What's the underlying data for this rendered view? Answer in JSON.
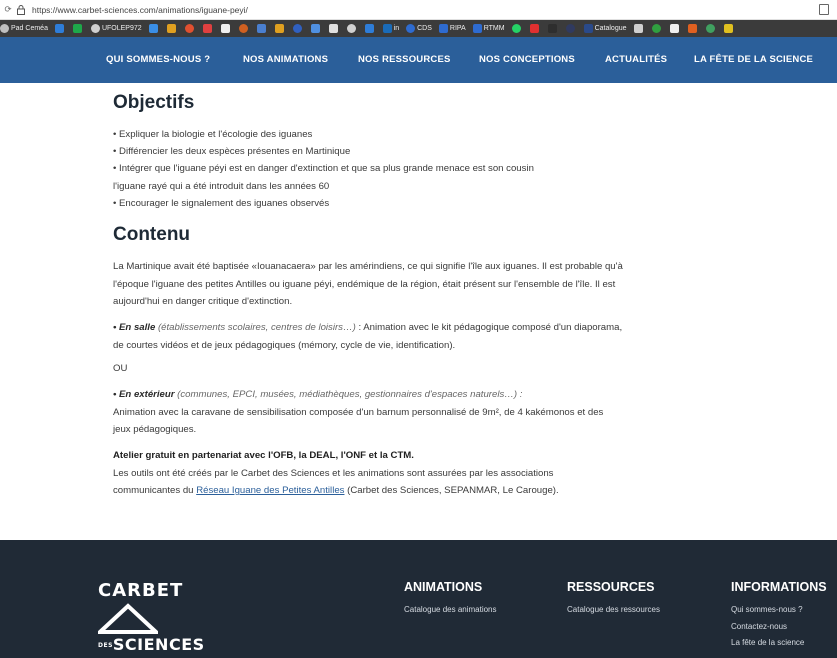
{
  "browser": {
    "url": "https://www.carbet-sciences.com/animations/iguane-peyi/",
    "bookmarks": [
      {
        "label": "Pad Ceméa",
        "color": "#bfbfbf"
      },
      {
        "label": "",
        "color": "#2e7dd8"
      },
      {
        "label": "",
        "color": "#1ea84a"
      },
      {
        "label": "UFOLEP972",
        "color": "#d0d0d0"
      },
      {
        "label": "",
        "color": "#3a8ee6"
      },
      {
        "label": "",
        "color": "#e0a020"
      },
      {
        "label": "",
        "color": "#e05030"
      },
      {
        "label": "",
        "color": "#e04040"
      },
      {
        "label": "",
        "color": "#f0f0f0"
      },
      {
        "label": "",
        "color": "#d06020"
      },
      {
        "label": "",
        "color": "#4a7fd0"
      },
      {
        "label": "",
        "color": "#e0a020"
      },
      {
        "label": "",
        "color": "#3060c0"
      },
      {
        "label": "",
        "color": "#5090e0"
      },
      {
        "label": "",
        "color": "#e0e0e0"
      },
      {
        "label": "",
        "color": "#d0d0d0"
      },
      {
        "label": "",
        "color": "#2e7dd8"
      },
      {
        "label": "in",
        "color": "#1a6bb8"
      },
      {
        "label": "CDS",
        "color": "#2e6bd0"
      },
      {
        "label": "RIPA",
        "color": "#2e6bd0"
      },
      {
        "label": "RTMM",
        "color": "#2e6bd0"
      },
      {
        "label": "",
        "color": "#25d366"
      },
      {
        "label": "",
        "color": "#e03030"
      },
      {
        "label": "",
        "color": "#2e2e2e"
      },
      {
        "label": "",
        "color": "#303a60"
      },
      {
        "label": "Catalogue",
        "color": "#2a4a8a"
      },
      {
        "label": "",
        "color": "#d0d0d0"
      },
      {
        "label": "",
        "color": "#30a040"
      },
      {
        "label": "",
        "color": "#f0f0f0"
      },
      {
        "label": "",
        "color": "#e06020"
      },
      {
        "label": "",
        "color": "#40a060"
      },
      {
        "label": "",
        "color": "#e0c020"
      }
    ]
  },
  "nav": {
    "items": [
      "QUI SOMMES-NOUS ?",
      "NOS ANIMATIONS",
      "NOS RESSOURCES",
      "NOS CONCEPTIONS",
      "ACTUALITÉS",
      "LA FÊTE DE LA SCIENCE"
    ]
  },
  "content": {
    "objectifs_title": "Objectifs",
    "objectifs": [
      "Expliquer la biologie et l'écologie des iguanes",
      "Différencier les deux espèces présentes en Martinique",
      "Intégrer que l'iguane péyi est en danger d'extinction et que sa plus grande menace est son cousin",
      "l'iguane rayé qui a été introduit dans les années 60",
      "Encourager le signalement des iguanes observés"
    ],
    "contenu_title": "Contenu",
    "p1": "La Martinique avait été baptisée «Iouanacaera» par les amérindiens, ce qui signifie l'île aux iguanes. Il est probable qu'à l'époque l'iguane des petites Antilles ou iguane péyi, endémique de la région, était présent sur l'ensemble de l'île. Il est aujourd'hui en danger critique d'extinction.",
    "p2_lead": "• En salle",
    "p2_italic": " (établissements scolaires, centres de loisirs…) ",
    "p2_rest": ": Animation avec le kit pédagogique composé d'un diaporama, de courtes vidéos et de jeux pédagogiques (mémory, cycle de vie, identification).",
    "p3": "OU",
    "p4_lead": "• En extérieur",
    "p4_italic": " (communes, EPCI, musées, médiathèques, gestionnaires d'espaces naturels…) :",
    "p4_rest": "Animation avec la caravane de sensibilisation composée d'un barnum personnalisé de 9m², de 4 kakémonos et des jeux pédagogiques.",
    "p5_bold": "Atelier gratuit en partenariat avec l'OFB, la DEAL, l'ONF et la CTM.",
    "p5_text": "Les outils ont été créés par le Carbet des Sciences et les animations sont assurées par les associations communicantes du ",
    "p5_link": "Réseau Iguane des Petites Antilles",
    "p5_end": " (Carbet des Sciences, SEPANMAR, Le Carouge)."
  },
  "footer": {
    "logo_top": "CARBET",
    "logo_bottom_prefix": "DES",
    "logo_bottom": "SCIENCES",
    "col1_title": "ANIMATIONS",
    "col1_links": [
      "Catalogue des animations"
    ],
    "col2_title": "RESSOURCES",
    "col2_links": [
      "Catalogue des ressources"
    ],
    "col3_title": "INFORMATIONS",
    "col3_links": [
      "Qui sommes-nous ?",
      "Contactez-nous",
      "La fête de la science"
    ]
  },
  "colors": {
    "nav_bg": "#2b5f9a",
    "footer_bg": "#202a36",
    "link": "#2b5f9a"
  }
}
